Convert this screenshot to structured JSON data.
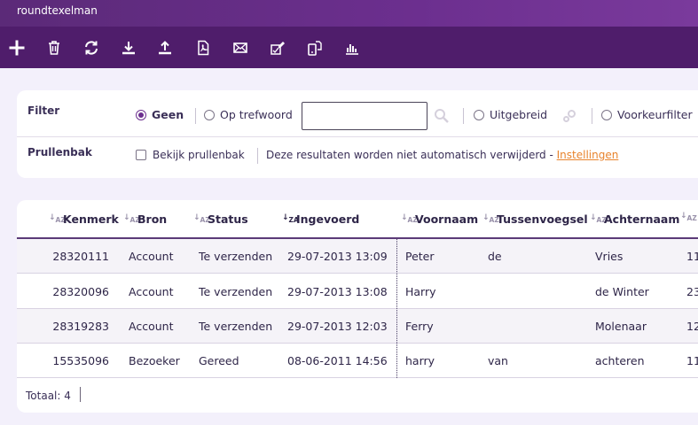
{
  "app": {
    "title": "roundtexelman"
  },
  "toolbar": {
    "buttons": [
      {
        "name": "add",
        "icon": "plus-icon"
      },
      {
        "name": "delete",
        "icon": "trash-icon"
      },
      {
        "name": "refresh",
        "icon": "refresh-icon"
      },
      {
        "name": "import",
        "icon": "download-icon"
      },
      {
        "name": "export",
        "icon": "upload-icon"
      },
      {
        "name": "pdf",
        "icon": "pdf-icon"
      },
      {
        "name": "email",
        "icon": "envelope-icon"
      },
      {
        "name": "sign",
        "icon": "pen-doc-icon"
      },
      {
        "name": "mobile",
        "icon": "phone-doc-icon"
      },
      {
        "name": "stats",
        "icon": "bar-chart-icon"
      }
    ]
  },
  "filter": {
    "label": "Filter",
    "options": {
      "none": "Geen",
      "keyword": "Op trefwoord",
      "extended": "Uitgebreid",
      "preference": "Voorkeurfilter"
    },
    "selected": "Geen",
    "keyword_value": "",
    "trash_label": "Prullenbak",
    "trash_checkbox": "Bekijk prullenbak",
    "info_text": "Deze resultaten worden niet automatisch verwijderd - ",
    "info_link": "Instellingen"
  },
  "grid": {
    "columns": [
      "Kenmerk",
      "Bron",
      "Status",
      "Ingevoerd",
      "Voornaam",
      "Tussenvoegsel",
      "Achternaam"
    ],
    "active_sort": "Ingevoerd",
    "rows": [
      {
        "kenmerk": "28320111",
        "bron": "Account",
        "status": "Te verzenden",
        "ingevoerd": "29-07-2013 13:09",
        "voornaam": "Peter",
        "tussenvoegsel": "de",
        "achternaam": "Vries",
        "extra": "11"
      },
      {
        "kenmerk": "28320096",
        "bron": "Account",
        "status": "Te verzenden",
        "ingevoerd": "29-07-2013 13:08",
        "voornaam": "Harry",
        "tussenvoegsel": "",
        "achternaam": "de Winter",
        "extra": "23"
      },
      {
        "kenmerk": "28319283",
        "bron": "Account",
        "status": "Te verzenden",
        "ingevoerd": "29-07-2013 12:03",
        "voornaam": "Ferry",
        "tussenvoegsel": "",
        "achternaam": "Molenaar",
        "extra": "12"
      },
      {
        "kenmerk": "15535096",
        "bron": "Bezoeker",
        "status": "Gereed",
        "ingevoerd": "08-06-2011 14:56",
        "voornaam": "harry",
        "tussenvoegsel": "van",
        "achternaam": "achteren",
        "extra": "11"
      }
    ],
    "total": "Totaal: 4"
  },
  "colors": {
    "header": "#5b2a78",
    "toolbar": "#4f1d6b",
    "accent": "#6c2f8f",
    "link": "#e8832c"
  }
}
